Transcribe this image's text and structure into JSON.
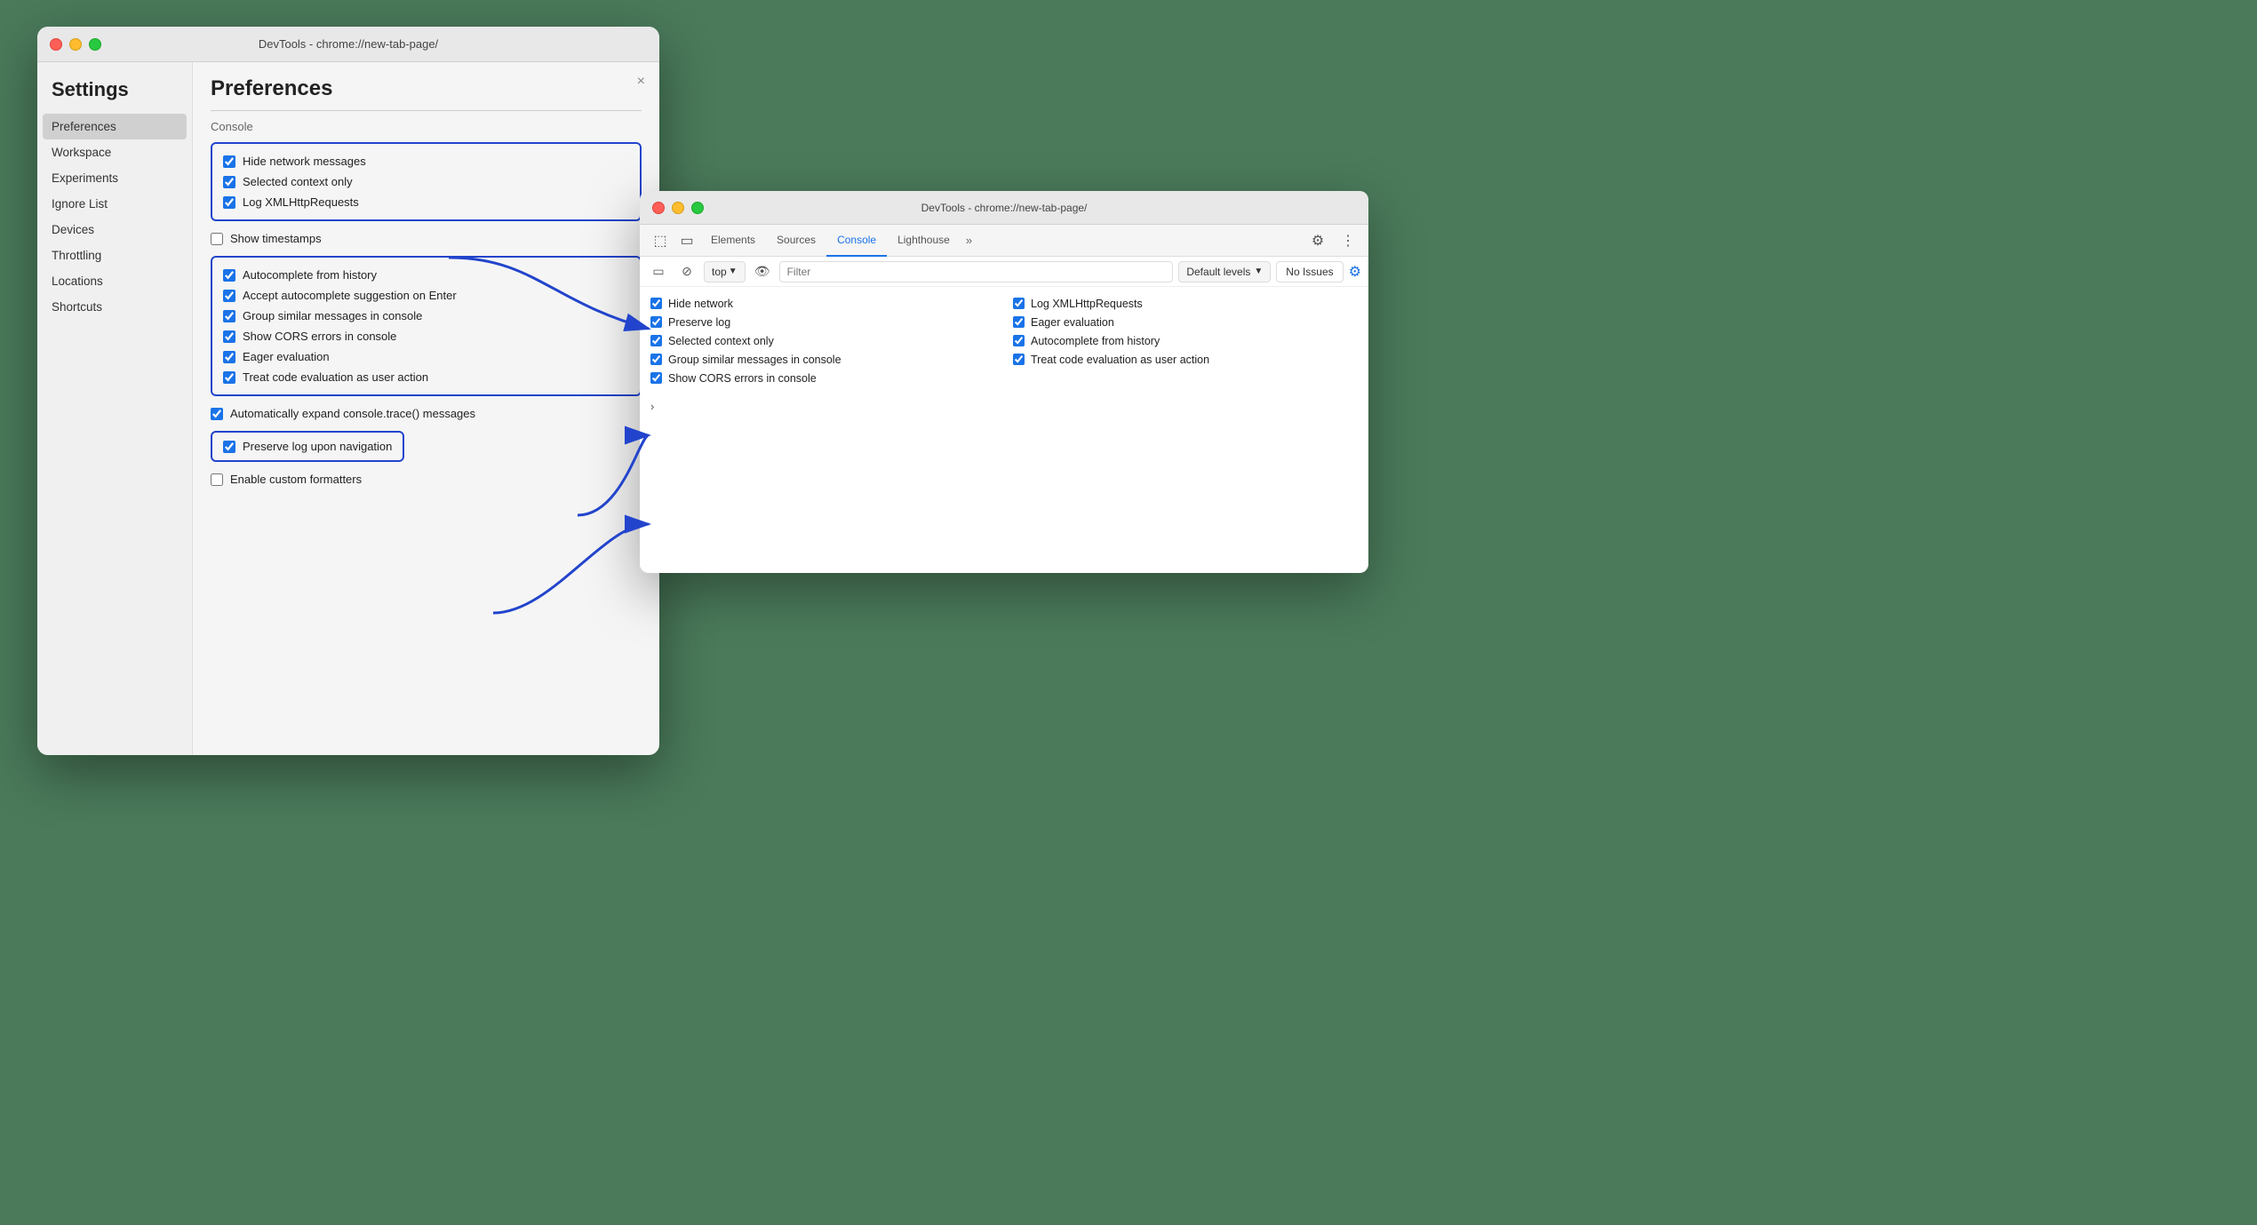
{
  "leftWindow": {
    "titlebar": {
      "title": "DevTools - chrome://new-tab-page/"
    },
    "settings": {
      "heading": "Settings",
      "closeBtn": "×"
    },
    "sidebar": {
      "items": [
        {
          "label": "Preferences",
          "active": true
        },
        {
          "label": "Workspace",
          "active": false
        },
        {
          "label": "Experiments",
          "active": false
        },
        {
          "label": "Ignore List",
          "active": false
        },
        {
          "label": "Devices",
          "active": false
        },
        {
          "label": "Throttling",
          "active": false
        },
        {
          "label": "Locations",
          "active": false
        },
        {
          "label": "Shortcuts",
          "active": false
        }
      ]
    },
    "preferences": {
      "title": "Preferences",
      "consoleSectionLabel": "Console",
      "group1": [
        {
          "label": "Hide network messages",
          "checked": true
        },
        {
          "label": "Selected context only",
          "checked": true
        },
        {
          "label": "Log XMLHttpRequests",
          "checked": true
        }
      ],
      "showTimestamps": {
        "label": "Show timestamps",
        "checked": false
      },
      "group2": [
        {
          "label": "Autocomplete from history",
          "checked": true
        },
        {
          "label": "Accept autocomplete suggestion on Enter",
          "checked": true
        },
        {
          "label": "Group similar messages in console",
          "checked": true
        },
        {
          "label": "Show CORS errors in console",
          "checked": true
        },
        {
          "label": "Eager evaluation",
          "checked": true
        },
        {
          "label": "Treat code evaluation as user action",
          "checked": true
        }
      ],
      "autoExpand": {
        "label": "Automatically expand console.trace() messages",
        "checked": true
      },
      "preserveLog": {
        "label": "Preserve log upon navigation",
        "checked": true
      },
      "customFormatters": {
        "label": "Enable custom formatters",
        "checked": false
      }
    }
  },
  "rightWindow": {
    "titlebar": {
      "title": "DevTools - chrome://new-tab-page/"
    },
    "tabs": [
      {
        "label": "Elements"
      },
      {
        "label": "Sources"
      },
      {
        "label": "Console",
        "active": true
      },
      {
        "label": "Lighthouse"
      }
    ],
    "toolbar": {
      "topLabel": "top",
      "filterPlaceholder": "Filter",
      "defaultLevels": "Default levels",
      "noIssues": "No Issues"
    },
    "consoleItems": {
      "col1": [
        {
          "label": "Hide network",
          "checked": true
        },
        {
          "label": "Preserve log",
          "checked": true
        },
        {
          "label": "Selected context only",
          "checked": true
        },
        {
          "label": "Group similar messages in console",
          "checked": true
        },
        {
          "label": "Show CORS errors in console",
          "checked": true
        }
      ],
      "col2": [
        {
          "label": "Log XMLHttpRequests",
          "checked": true
        },
        {
          "label": "Eager evaluation",
          "checked": true
        },
        {
          "label": "Autocomplete from history",
          "checked": true
        },
        {
          "label": "Treat code evaluation as user action",
          "checked": true
        }
      ]
    }
  }
}
